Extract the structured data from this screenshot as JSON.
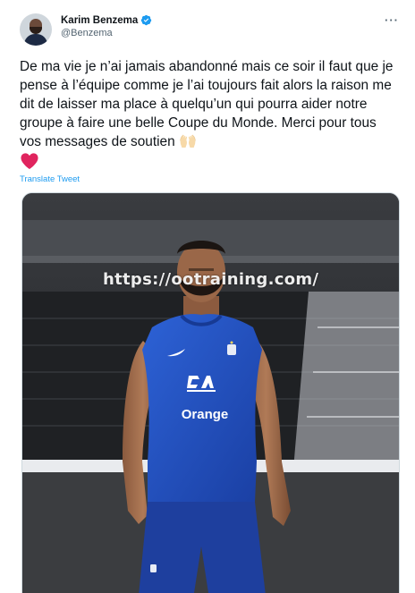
{
  "author": {
    "display_name": "Karim Benzema",
    "handle": "@Benzema"
  },
  "tweet": {
    "text": "De ma vie je n’ai jamais abandonné mais ce soir il faut que je pense à l’équipe comme je l’ai toujours fait alors la raison me dit de laisser ma place à quelqu’un qui pourra aider notre groupe à faire une belle Coupe du Monde. Merci pour tous vos messages de soutien",
    "translate_label": "Translate Tweet"
  },
  "media": {
    "watermark": "https://ootraining.com/",
    "jersey_sponsor": "Orange"
  },
  "colors": {
    "link": "#1d9bf0",
    "verified": "#1d9bf0",
    "heart": "#e0245e"
  },
  "icons": {
    "more": "more-options-icon",
    "verified": "verified-badge-icon"
  }
}
